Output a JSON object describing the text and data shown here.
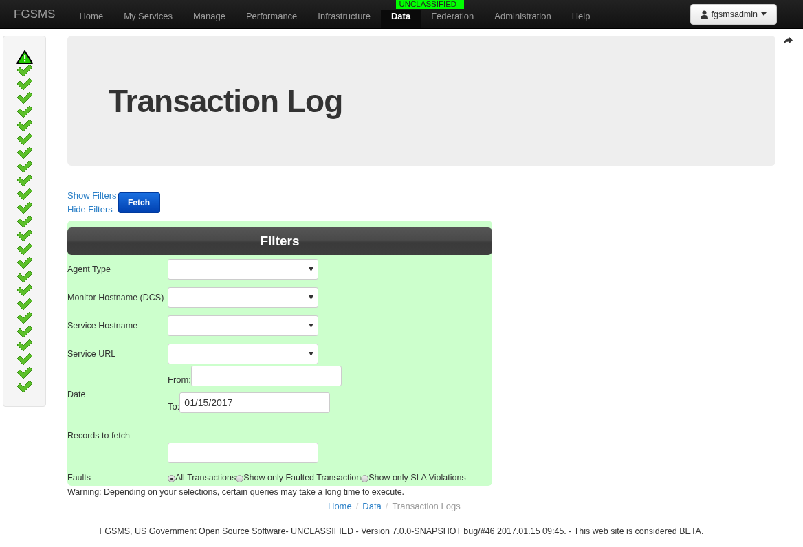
{
  "navbar": {
    "brand": "FGSMS",
    "items": [
      {
        "label": "Home",
        "selected": false
      },
      {
        "label": "My Services",
        "selected": false
      },
      {
        "label": "Manage",
        "selected": false
      },
      {
        "label": "Performance",
        "selected": false
      },
      {
        "label": "Infrastructure",
        "selected": false
      },
      {
        "label": "Data",
        "selected": true
      },
      {
        "label": "Federation",
        "selected": false
      },
      {
        "label": "Administration",
        "selected": false
      },
      {
        "label": "Help",
        "selected": false
      }
    ],
    "classification_badge": "UNCLASSIFIED -",
    "user_menu": "fgsmsadmin"
  },
  "status_sidebar": [
    {
      "kind": "warning"
    },
    {
      "kind": "ok"
    },
    {
      "kind": "ok"
    },
    {
      "kind": "ok"
    },
    {
      "kind": "ok"
    },
    {
      "kind": "ok"
    },
    {
      "kind": "ok"
    },
    {
      "kind": "ok"
    },
    {
      "kind": "ok"
    },
    {
      "kind": "ok"
    },
    {
      "kind": "ok"
    },
    {
      "kind": "ok"
    },
    {
      "kind": "ok"
    },
    {
      "kind": "ok"
    },
    {
      "kind": "ok"
    },
    {
      "kind": "ok"
    },
    {
      "kind": "ok"
    },
    {
      "kind": "ok"
    },
    {
      "kind": "ok"
    },
    {
      "kind": "ok"
    },
    {
      "kind": "ok"
    },
    {
      "kind": "ok"
    },
    {
      "kind": "ok"
    },
    {
      "kind": "ok"
    },
    {
      "kind": "ok"
    }
  ],
  "page_title": "Transaction Log",
  "links": [
    "Show Filters",
    "Hide Filters"
  ],
  "fetch_button": "Fetch",
  "filters": {
    "title": "Filters",
    "rows": [
      {
        "kind": "select",
        "label": "Agent Type"
      },
      {
        "kind": "select",
        "label": "Monitor Hostname (DCS)"
      },
      {
        "kind": "select",
        "label": "Service Hostname"
      },
      {
        "kind": "select",
        "label": "Service URL"
      },
      {
        "kind": "date",
        "label": "Date",
        "from_label": "From:",
        "from_value": "",
        "to_label": "To:",
        "to_value": "01/15/2017"
      },
      {
        "kind": "text",
        "label": "Records to fetch"
      },
      {
        "kind": "radio",
        "label": "Faults",
        "options": [
          {
            "label": "All Transactions",
            "selected": true
          },
          {
            "label": "Show only Faulted Transaction",
            "selected": false
          },
          {
            "label": "Show only SLA Violations",
            "selected": false
          }
        ]
      }
    ]
  },
  "warning": "Warning: Depending on your selections, certain queries may take a long time to execute.",
  "breadcrumb_separator": "/",
  "breadcrumb": [
    {
      "label": "Home",
      "link": true
    },
    {
      "label": "Data",
      "link": true
    },
    {
      "label": "Transaction Logs",
      "link": false
    }
  ],
  "footer": "FGSMS, US Government Open Source Software- UNCLASSIFIED - Version 7.0.0-SNAPSHOT bug/#46 2017.01.15 09:45. - This web site is considered BETA."
}
